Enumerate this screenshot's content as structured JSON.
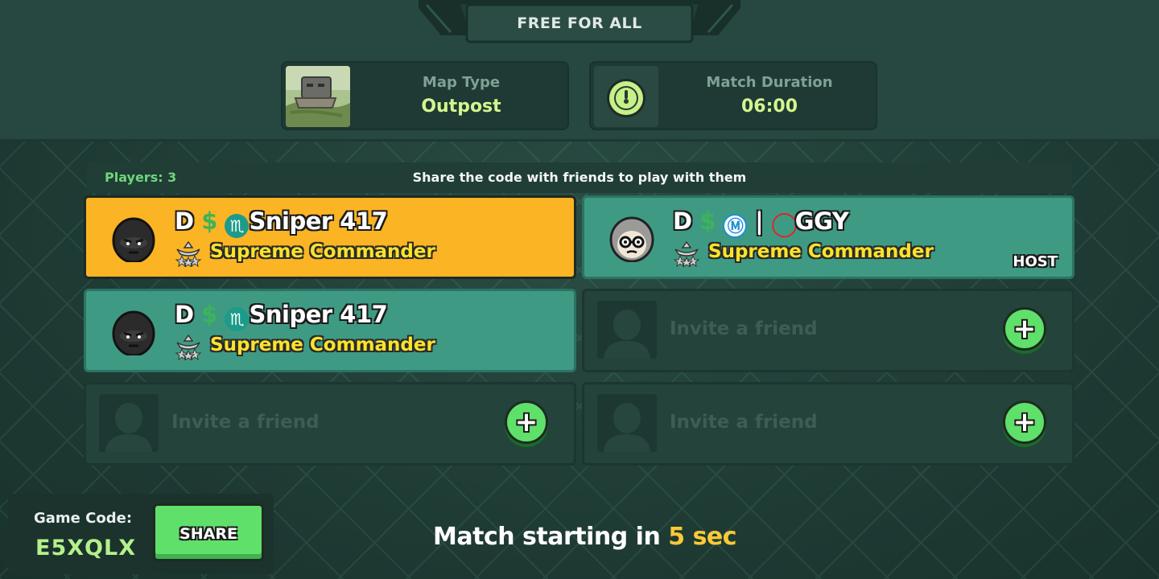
{
  "mode": {
    "title": "FREE FOR ALL"
  },
  "map": {
    "label": "Map Type",
    "value": "Outpost"
  },
  "duration": {
    "label": "Match Duration",
    "value": "06:00"
  },
  "lobby": {
    "players_label": "Players: 3",
    "share_hint": "Share the code with friends to play with them"
  },
  "players": [
    {
      "prefix": "D",
      "money": "$",
      "badge": "♏",
      "name": "Sniper 417",
      "rank": "Supreme Commander",
      "self": true
    },
    {
      "prefix": "D",
      "money": "$",
      "badge": "Ⓜ",
      "sep": "|",
      "ring": "◯",
      "name": "GGY",
      "rank": "Supreme Commander",
      "host": "HOST"
    },
    {
      "prefix": "D",
      "money": "$",
      "badge": "♏",
      "name": "Sniper 417",
      "rank": "Supreme Commander"
    }
  ],
  "invite": {
    "text": "Invite a friend",
    "plus": "+"
  },
  "game_code": {
    "label": "Game Code:",
    "value": "E5XQLX",
    "share_label": "SHARE"
  },
  "countdown": {
    "prefix": "Match starting in ",
    "value": "5 sec"
  },
  "colors": {
    "self_slot": "#fbb423",
    "player_slot": "#3f9a84",
    "accent_green": "#5fe06a",
    "rank_yellow": "#fbe32a"
  }
}
